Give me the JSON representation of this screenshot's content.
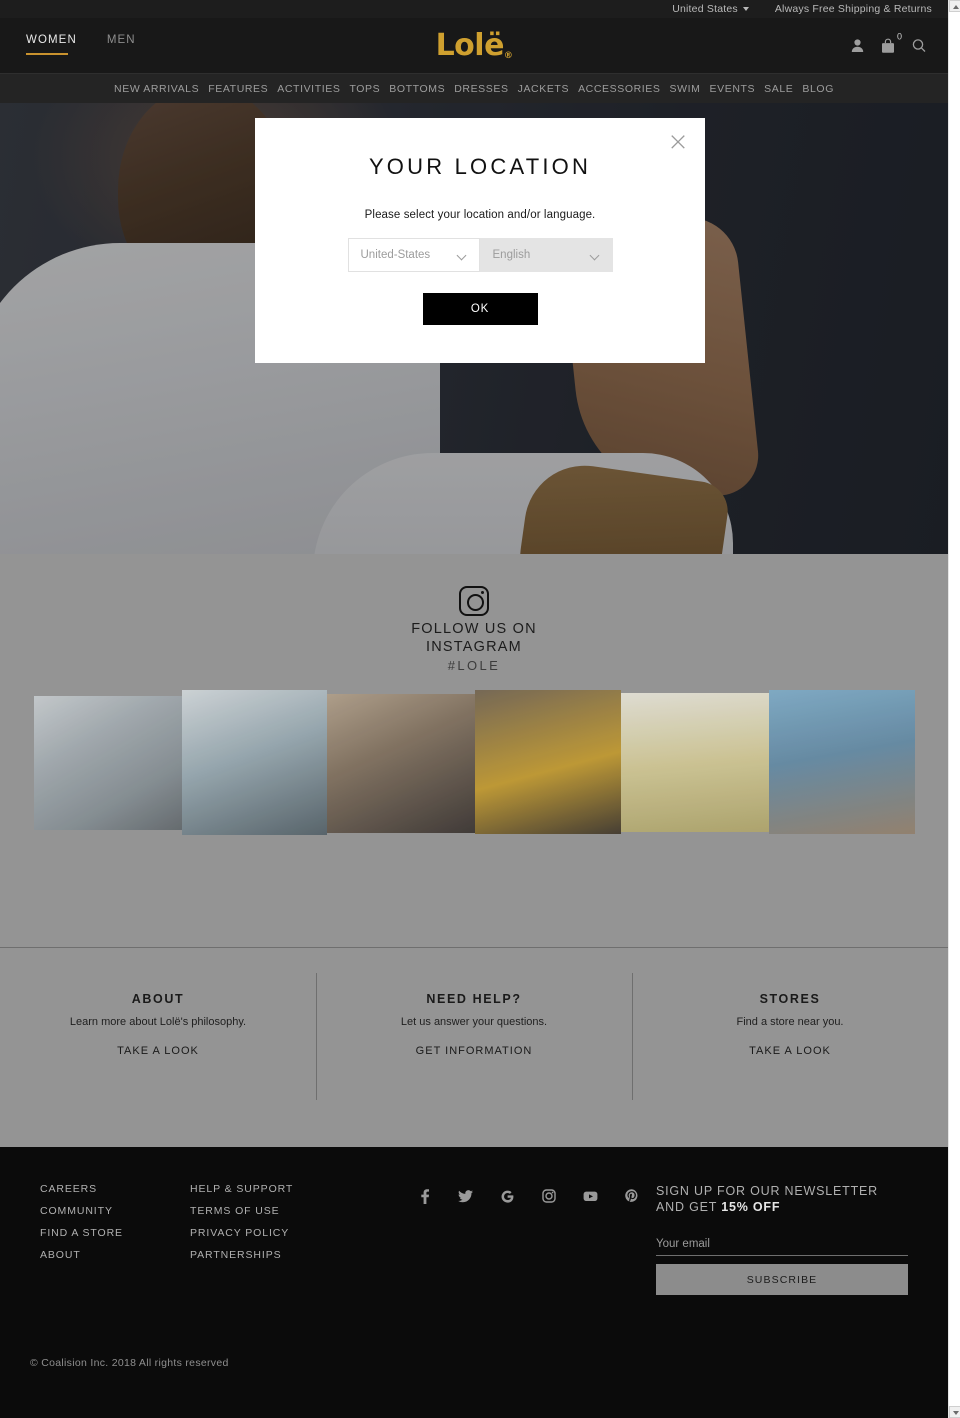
{
  "utilbar": {
    "country": "United States",
    "shipping": "Always Free Shipping & Returns"
  },
  "header": {
    "logo": "Lolë",
    "logo_reg": "®",
    "tabs": [
      {
        "label": "WOMEN",
        "active": true
      },
      {
        "label": "MEN",
        "active": false
      }
    ],
    "cart_count": "0",
    "icons": [
      "account-icon",
      "cart-icon",
      "search-icon"
    ]
  },
  "catnav": {
    "items": [
      "NEW ARRIVALS",
      "FEATURES",
      "ACTIVITIES",
      "TOPS",
      "BOTTOMS",
      "DRESSES",
      "JACKETS",
      "ACCESSORIES",
      "SWIM",
      "EVENTS",
      "SALE",
      "BLOG"
    ]
  },
  "modal": {
    "title": "YOUR LOCATION",
    "subtitle": "Please select your location and/or language.",
    "country_value": "United-States",
    "language_value": "English",
    "ok_label": "OK",
    "close_icon": "×"
  },
  "instagram": {
    "line1": "FOLLOW US ON",
    "line2": "INSTAGRAM",
    "hashtag": "#LOLE",
    "icon": "instagram-icon",
    "photo_count": 6
  },
  "info": {
    "columns": [
      {
        "title": "ABOUT",
        "desc": "Learn more about Lolë's philosophy.",
        "link": "TAKE A LOOK"
      },
      {
        "title": "NEED HELP?",
        "desc": "Let us answer your questions.",
        "link": "GET INFORMATION"
      },
      {
        "title": "STORES",
        "desc": "Find a store near you.",
        "link": "TAKE A LOOK"
      }
    ]
  },
  "footer": {
    "col1": [
      "CAREERS",
      "COMMUNITY",
      "FIND A STORE",
      "ABOUT"
    ],
    "col2": [
      "HELP & SUPPORT",
      "TERMS OF USE",
      "PRIVACY POLICY",
      "PARTNERSHIPS"
    ],
    "social": [
      "facebook-icon",
      "twitter-icon",
      "google-icon",
      "instagram-icon",
      "youtube-icon",
      "pinterest-icon"
    ],
    "newsletter": {
      "title_line1": "SIGN UP FOR OUR NEWSLETTER",
      "title_line2_pre": "AND GET ",
      "title_line2_strong": "15% OFF",
      "placeholder": "Your email",
      "value": "",
      "button": "SUBSCRIBE"
    },
    "copyright": "© Coalision Inc. 2018 All rights reserved"
  },
  "colors": {
    "brand_gold": "#cfa02f",
    "header_dark": "#181818",
    "footer_dark": "#0b0b0b",
    "band_gray": "#949494"
  }
}
